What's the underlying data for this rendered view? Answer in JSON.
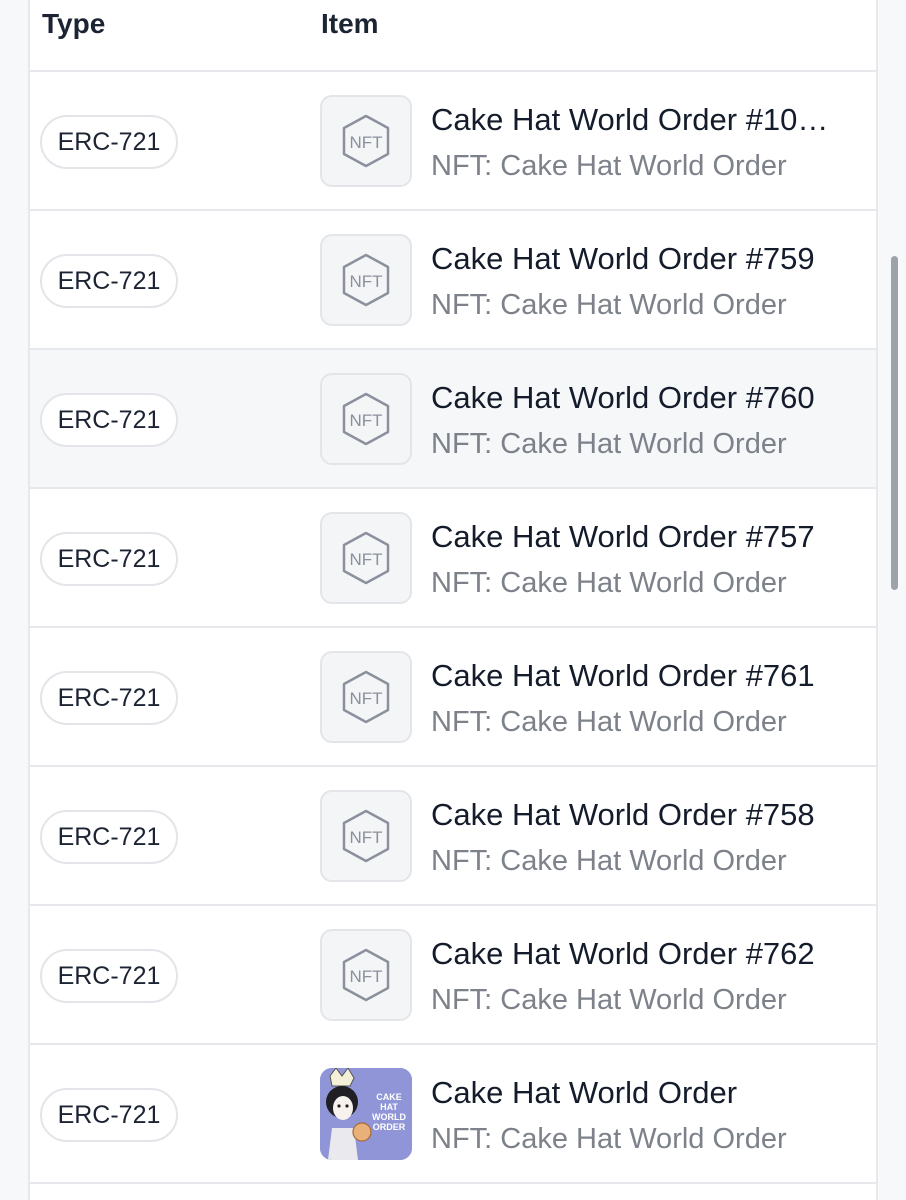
{
  "table": {
    "headers": {
      "type": "Type",
      "item": "Item"
    },
    "rows": [
      {
        "type": "ERC-721",
        "title": "Cake Hat World Order #10…",
        "subtitle": "NFT: Cake Hat World Order",
        "thumb": "nft-placeholder-icon",
        "thumb_text": "NFT"
      },
      {
        "type": "ERC-721",
        "title": "Cake Hat World Order #759",
        "subtitle": "NFT: Cake Hat World Order",
        "thumb": "nft-placeholder-icon",
        "thumb_text": "NFT"
      },
      {
        "type": "ERC-721",
        "title": "Cake Hat World Order #760",
        "subtitle": "NFT: Cake Hat World Order",
        "thumb": "nft-placeholder-icon",
        "thumb_text": "NFT",
        "highlighted": true
      },
      {
        "type": "ERC-721",
        "title": "Cake Hat World Order #757",
        "subtitle": "NFT: Cake Hat World Order",
        "thumb": "nft-placeholder-icon",
        "thumb_text": "NFT"
      },
      {
        "type": "ERC-721",
        "title": "Cake Hat World Order #761",
        "subtitle": "NFT: Cake Hat World Order",
        "thumb": "nft-placeholder-icon",
        "thumb_text": "NFT"
      },
      {
        "type": "ERC-721",
        "title": "Cake Hat World Order #758",
        "subtitle": "NFT: Cake Hat World Order",
        "thumb": "nft-placeholder-icon",
        "thumb_text": "NFT"
      },
      {
        "type": "ERC-721",
        "title": "Cake Hat World Order #762",
        "subtitle": "NFT: Cake Hat World Order",
        "thumb": "nft-placeholder-icon",
        "thumb_text": "NFT"
      },
      {
        "type": "ERC-721",
        "title": "Cake Hat World Order",
        "subtitle": "NFT: Cake Hat World Order",
        "thumb": "collection-artwork",
        "art_text": [
          "CAKE",
          "HAT",
          "WORLD",
          "ORDER"
        ]
      }
    ]
  },
  "colors": {
    "title": "#141c2b",
    "subtitle": "#7c818a",
    "border": "#e6e8ec",
    "highlight_row": "#f6f7f9",
    "icon_stroke": "#8a919c",
    "art_background": "#8f95d6"
  }
}
